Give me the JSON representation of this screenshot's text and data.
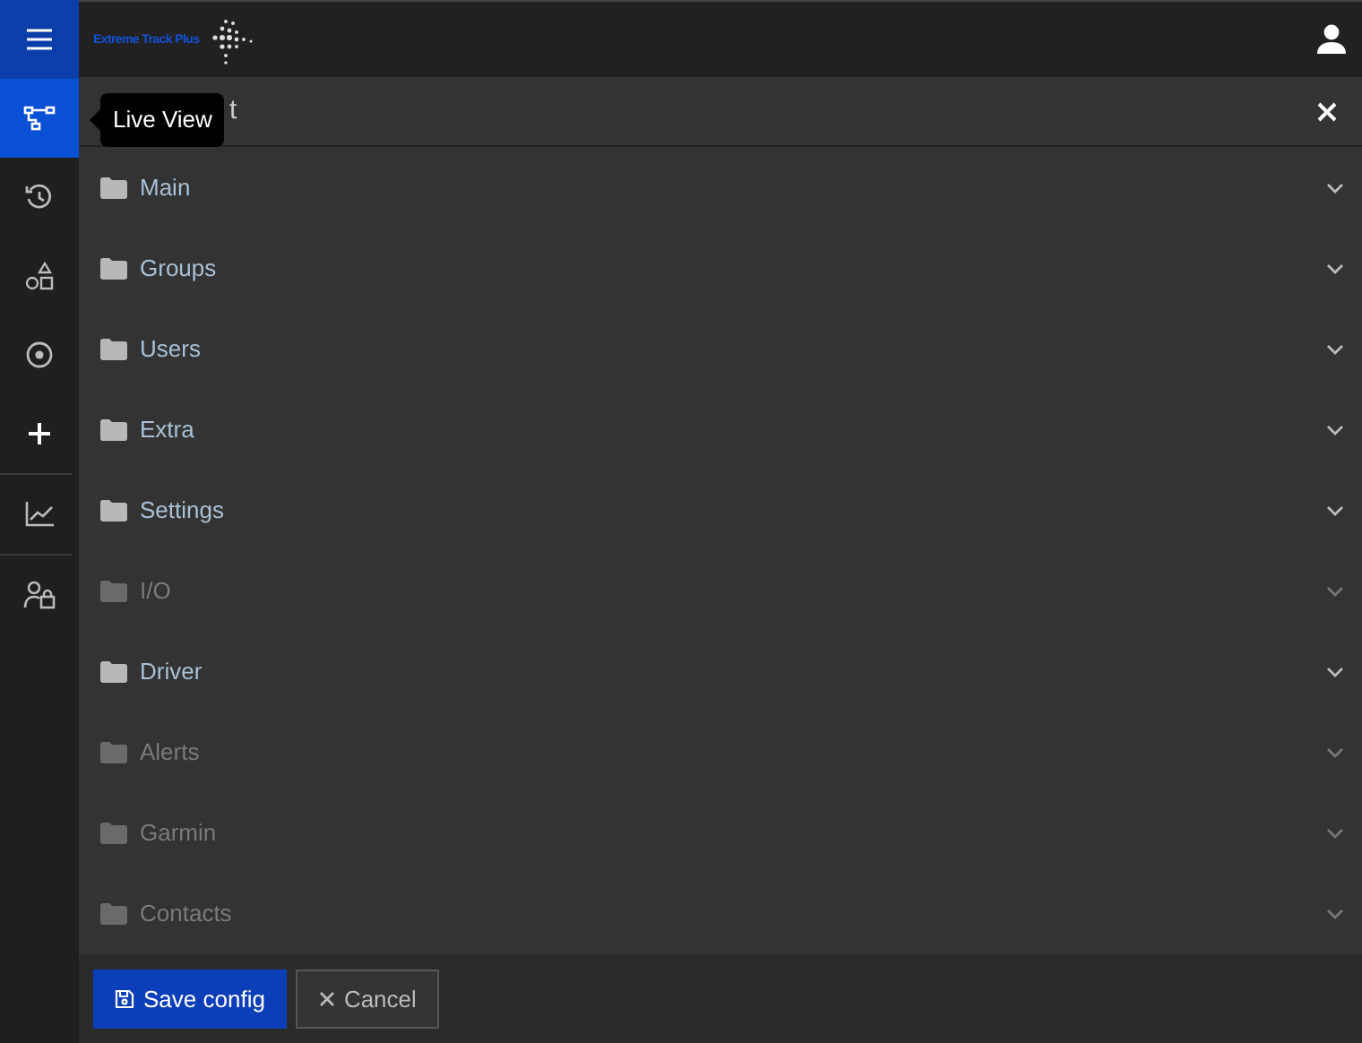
{
  "logo": {
    "text": "Extreme Track Plus"
  },
  "sidebar": {
    "groups": [
      {
        "items": [
          {
            "selected": false
          },
          {
            "selected": true
          },
          {
            "selected": false
          },
          {
            "selected": false
          },
          {
            "selected": false
          },
          {
            "selected": false
          }
        ]
      },
      {
        "items": [
          {
            "selected": false
          }
        ]
      },
      {
        "items": [
          {
            "selected": false
          }
        ]
      }
    ]
  },
  "tooltip": {
    "text": "Live View"
  },
  "panel": {
    "title": "t",
    "sections": [
      {
        "label": "Main",
        "disabled": false
      },
      {
        "label": "Groups",
        "disabled": false
      },
      {
        "label": "Users",
        "disabled": false
      },
      {
        "label": "Extra",
        "disabled": false
      },
      {
        "label": "Settings",
        "disabled": false
      },
      {
        "label": "I/O",
        "disabled": true
      },
      {
        "label": "Driver",
        "disabled": false
      },
      {
        "label": "Alerts",
        "disabled": true
      },
      {
        "label": "Garmin",
        "disabled": true
      },
      {
        "label": "Contacts",
        "disabled": true
      }
    ]
  },
  "buttons": [
    {
      "label": "Save config",
      "kind": "primary"
    },
    {
      "label": "Cancel",
      "kind": "secondary"
    }
  ]
}
